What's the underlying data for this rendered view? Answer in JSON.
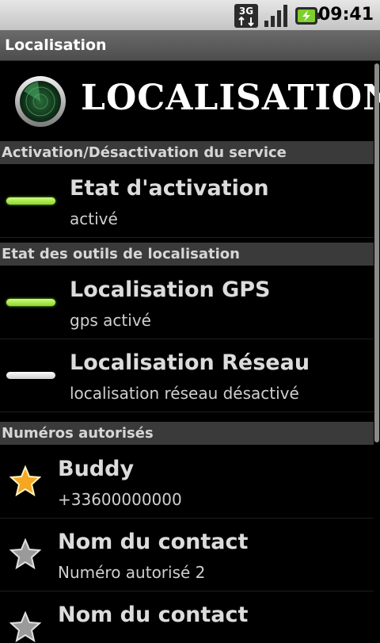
{
  "status_bar": {
    "network_type": "3G",
    "time": "09:41",
    "icons": [
      "3g-icon",
      "signal-icon",
      "battery-charging-icon"
    ]
  },
  "titlebar": {
    "title": "Localisation"
  },
  "header": {
    "title": "LOCALISATION",
    "icon": "radar-icon"
  },
  "sections": {
    "activation": {
      "header": "Activation/Désactivation du service",
      "items": [
        {
          "title": "Etat d'activation",
          "subtitle": "activé",
          "state": "on"
        }
      ]
    },
    "tools": {
      "header": "Etat des outils de localisation",
      "items": [
        {
          "title": "Localisation GPS",
          "subtitle": "gps activé",
          "state": "on"
        },
        {
          "title": "Localisation Réseau",
          "subtitle": "localisation réseau désactivé",
          "state": "off"
        }
      ]
    },
    "numbers": {
      "header": "Numéros autorisés",
      "items": [
        {
          "title": "Buddy",
          "subtitle": "+33600000000",
          "starred": true
        },
        {
          "title": "Nom du contact",
          "subtitle": "Numéro autorisé 2",
          "starred": false
        },
        {
          "title": "Nom du contact",
          "subtitle": "",
          "starred": false
        }
      ]
    }
  },
  "colors": {
    "indicator_on": "#9be33a",
    "indicator_off": "#e8e8e8",
    "section_bg": "#3a3a3a",
    "star_gold": "#f5a623"
  }
}
